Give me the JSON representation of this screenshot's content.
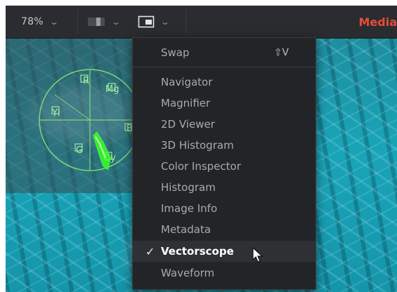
{
  "toolbar": {
    "zoom_value": "78%",
    "zoom_dropdown_icon": "chevron-down-icon",
    "layout_icon": "single-viewer-icon",
    "viewer_mode_icon": "viewer-window-icon",
    "right_label": "Media"
  },
  "menu": {
    "swap_label": "Swap",
    "swap_shortcut": "⇧V",
    "items": [
      {
        "label": "Navigator"
      },
      {
        "label": "Magnifier"
      },
      {
        "label": "2D Viewer"
      },
      {
        "label": "3D Histogram"
      },
      {
        "label": "Color Inspector"
      },
      {
        "label": "Histogram"
      },
      {
        "label": "Image Info"
      },
      {
        "label": "Metadata"
      },
      {
        "label": "Vectorscope"
      },
      {
        "label": "Waveform"
      }
    ],
    "selected": "Vectorscope",
    "check_glyph": "✓"
  },
  "vectorscope": {
    "labels": [
      "R",
      "Mg",
      "Yl",
      "B",
      "G",
      "Cy"
    ]
  },
  "colors": {
    "accent": "#e84b3a",
    "trace": "#3cff2a",
    "graticule": "#7dd87a"
  }
}
